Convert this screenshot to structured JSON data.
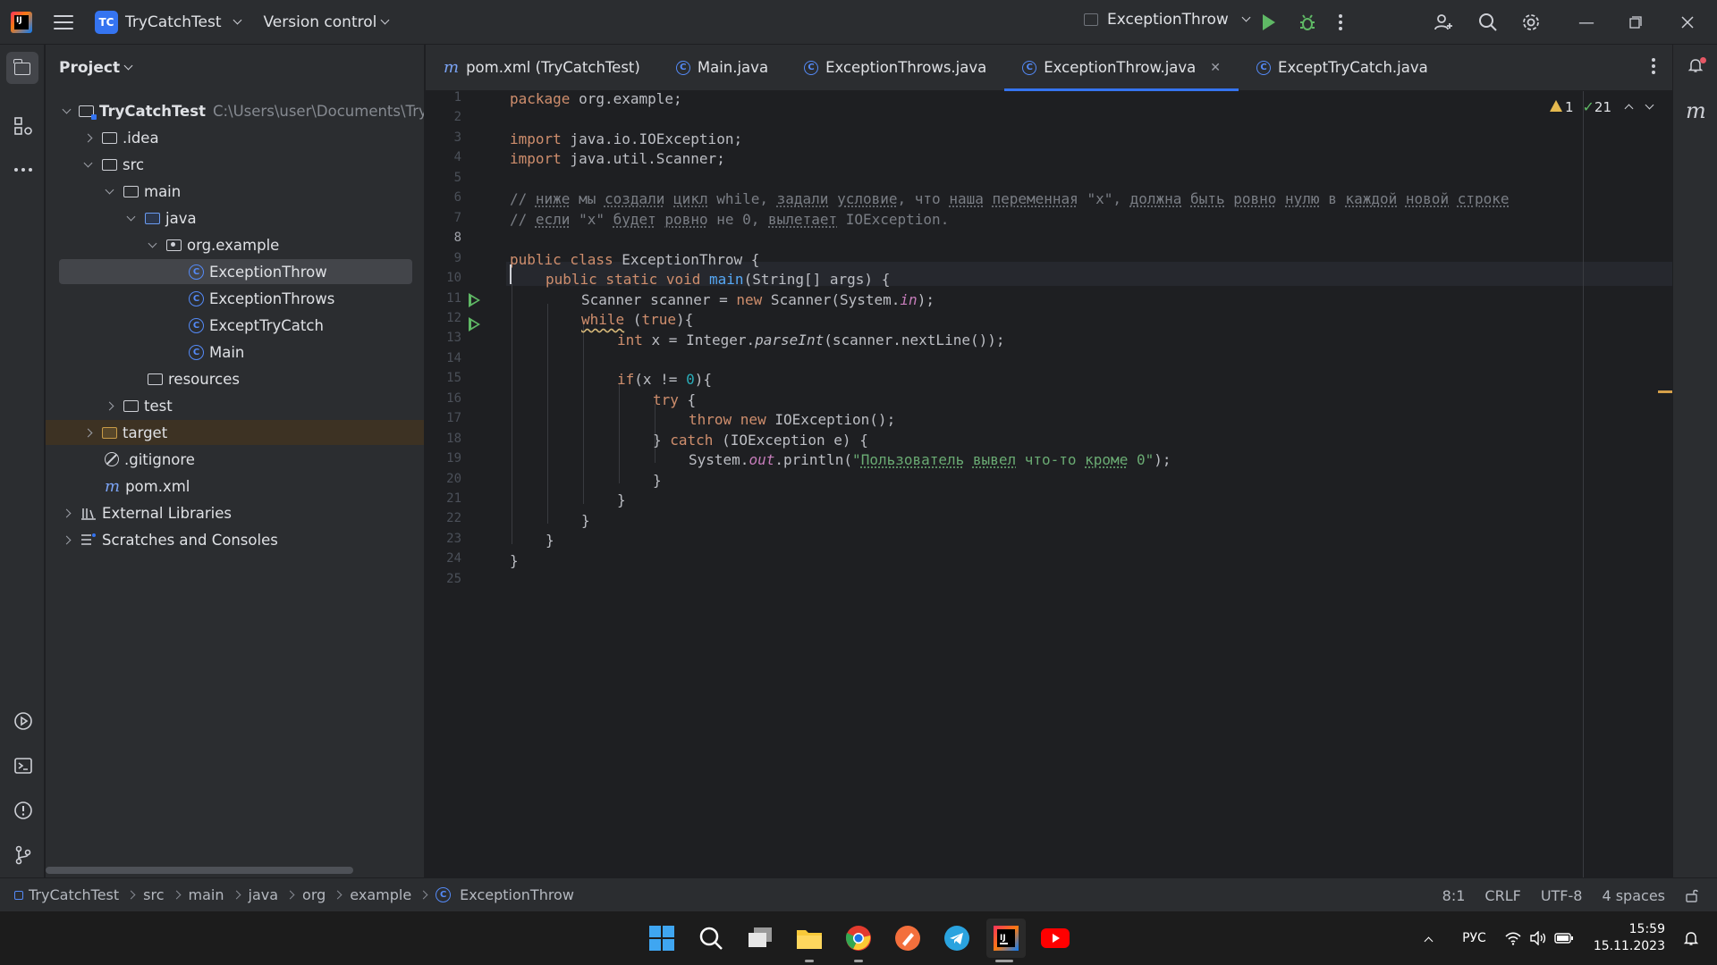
{
  "titlebar": {
    "project_badge": "TC",
    "project_name": "TryCatchTest",
    "vcs_label": "Version control",
    "run_config": "ExceptionThrow",
    "icons": [
      "hamburger-menu-icon",
      "run-icon",
      "debug-icon",
      "more-icon",
      "add-user-icon",
      "search-icon",
      "settings-icon",
      "minimize-icon",
      "restore-icon",
      "close-icon"
    ]
  },
  "project_panel": {
    "title": "Project",
    "tree": [
      {
        "label": "TryCatchTest",
        "hint": "C:\\Users\\user\\Documents\\TryC"
      },
      {
        "label": ".idea"
      },
      {
        "label": "src"
      },
      {
        "label": "main"
      },
      {
        "label": "java"
      },
      {
        "label": "org.example"
      },
      {
        "label": "ExceptionThrow"
      },
      {
        "label": "ExceptionThrows"
      },
      {
        "label": "ExceptTryCatch"
      },
      {
        "label": "Main"
      },
      {
        "label": "resources"
      },
      {
        "label": "test"
      },
      {
        "label": "target"
      },
      {
        "label": ".gitignore"
      },
      {
        "label": "pom.xml"
      },
      {
        "label": "External Libraries"
      },
      {
        "label": "Scratches and Consoles"
      }
    ]
  },
  "tabs": [
    {
      "label": "pom.xml (TryCatchTest)"
    },
    {
      "label": "Main.java"
    },
    {
      "label": "ExceptionThrows.java"
    },
    {
      "label": "ExceptionThrow.java",
      "active": true
    },
    {
      "label": "ExceptTryCatch.java"
    }
  ],
  "editor": {
    "warnings_count": "1",
    "ok_count": "21",
    "line_numbers": [
      "1",
      "2",
      "3",
      "4",
      "5",
      "6",
      "7",
      "8",
      "9",
      "10",
      "11",
      "12",
      "13",
      "14",
      "15",
      "16",
      "17",
      "18",
      "19",
      "20",
      "21",
      "22",
      "23",
      "24",
      "25"
    ],
    "code": {
      "l1_kw": "package",
      "l1_rest": " org.example;",
      "l3_kw": "import",
      "l3_rest": " java.io.IOException;",
      "l4_kw": "import",
      "l4_rest": " java.util.Scanner;",
      "l6": {
        "a": "// ",
        "b": "ниже",
        "c": " мы ",
        "d": "создали",
        "e": " ",
        "f": "цикл",
        "g": " while, ",
        "h": "задали",
        "i": " ",
        "j": "условие",
        "k": ", что ",
        "l": "наша",
        "m": " ",
        "n": "переменная",
        "o": " \"x\", ",
        "p": "должна",
        "q": " ",
        "r": "быть",
        "s": " ",
        "t": "ровно",
        "u": " ",
        "v": "нулю",
        "w": " в ",
        "x": "каждой",
        "y": " ",
        "z": "новой",
        "z1": " ",
        "z2": "строке"
      },
      "l7": {
        "a": "// ",
        "b": "если",
        "c": " \"x\" ",
        "d": "будет",
        "e": " ",
        "f": "ровно",
        "g": " не 0, ",
        "h": "вылетает",
        "i": " IOException."
      },
      "l9": {
        "a": "public class",
        "b": " ExceptionThrow {"
      },
      "l10": {
        "a": "public static void",
        "b": "main",
        "c": "(String[] args) {"
      },
      "l11": {
        "a": "Scanner scanner = ",
        "b": "new",
        "c": " Scanner(System.",
        "d": "in",
        "e": ");"
      },
      "l12": {
        "a": "while",
        "b": " (",
        "c": "true",
        "d": "){"
      },
      "l13": {
        "a": "int",
        "b": " x = Integer.",
        "c": "parseInt",
        "d": "(scanner.nextLine());"
      },
      "l15": {
        "a": "if",
        "b": "(x != ",
        "c": "0",
        "d": "){"
      },
      "l16": {
        "a": "try",
        "b": " {"
      },
      "l17": {
        "a": "throw new",
        "b": " IOException();"
      },
      "l18": {
        "a": "} ",
        "b": "catch",
        "c": " (IOException e) {"
      },
      "l19": {
        "a": "System.",
        "b": "out",
        "c": ".println(",
        "d": "\"",
        "e": "Пользователь",
        "f": " ",
        "g": "вывел",
        "h": " что-то ",
        "i": "кроме",
        "j": " 0\"",
        "k": ");"
      },
      "l20": "}",
      "l21": "}",
      "l22": "}",
      "l23": "}",
      "l24": "}"
    }
  },
  "statusbar": {
    "breadcrumbs": [
      "TryCatchTest",
      "src",
      "main",
      "java",
      "org",
      "example",
      "ExceptionThrow"
    ],
    "position": "8:1",
    "line_sep": "CRLF",
    "encoding": "UTF-8",
    "indent": "4 spaces"
  },
  "taskbar": {
    "lang": "РУС",
    "time": "15:59",
    "date": "15.11.2023"
  },
  "colors": {
    "accent": "#3574f0",
    "keyword": "#cf8e6d",
    "string": "#6aab73",
    "comment": "#7a7e85",
    "number": "#2aacb8",
    "function": "#56a8f5",
    "run_green": "#5fb865"
  }
}
